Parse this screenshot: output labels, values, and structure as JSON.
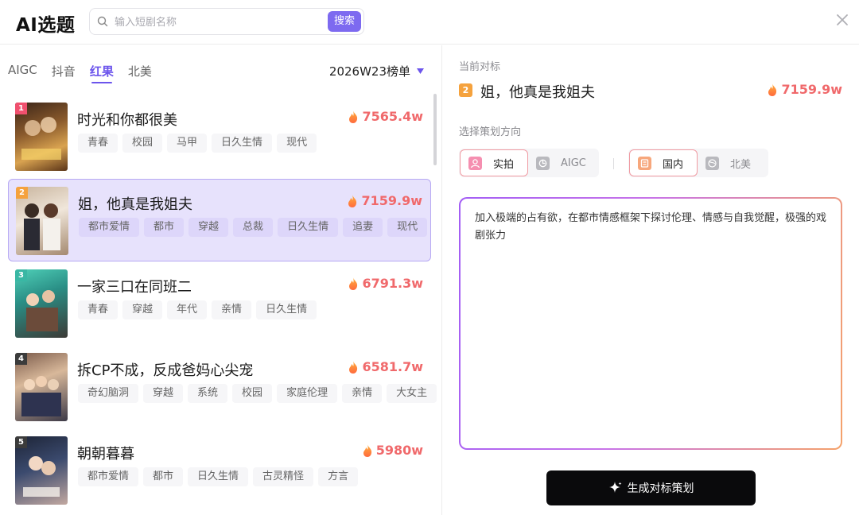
{
  "header": {
    "app_title": "AI选题",
    "search_placeholder": "输入短剧名称",
    "search_button": "搜索"
  },
  "left": {
    "tabs": [
      {
        "label": "AIGC",
        "active": false
      },
      {
        "label": "抖音",
        "active": false
      },
      {
        "label": "红果",
        "active": true
      },
      {
        "label": "北美",
        "active": false
      }
    ],
    "week_label": "2026W23榜单",
    "items": [
      {
        "rank": "1",
        "title": "时光和你都很美",
        "heat": "7565.4w",
        "tags": [
          "青春",
          "校园",
          "马甲",
          "日久生情",
          "现代"
        ],
        "rank_color": "#f0506e"
      },
      {
        "rank": "2",
        "title": "姐，他真是我姐夫",
        "heat": "7159.9w",
        "tags": [
          "都市爱情",
          "都市",
          "穿越",
          "总裁",
          "日久生情",
          "追妻",
          "现代"
        ],
        "rank_color": "#f5a23d"
      },
      {
        "rank": "3",
        "title": "一家三口在同班二",
        "heat": "6791.3w",
        "tags": [
          "青春",
          "穿越",
          "年代",
          "亲情",
          "日久生情"
        ],
        "rank_color": "#39b7a4"
      },
      {
        "rank": "4",
        "title": "拆CP不成，反成爸妈心尖宠",
        "heat": "6581.7w",
        "tags": [
          "奇幻脑洞",
          "穿越",
          "系统",
          "校园",
          "家庭伦理",
          "亲情",
          "大女主"
        ],
        "rank_color": "#3b3b3b"
      },
      {
        "rank": "5",
        "title": "朝朝暮暮",
        "heat": "5980w",
        "tags": [
          "都市爱情",
          "都市",
          "日久生情",
          "古灵精怪",
          "方言"
        ],
        "rank_color": "#3b3b3b"
      }
    ]
  },
  "right": {
    "current_target_label": "当前对标",
    "target": {
      "rank": "2",
      "title": "姐，他真是我姐夫",
      "heat": "7159.9w"
    },
    "direction_label": "选择策划方向",
    "style_options": [
      {
        "label": "实拍",
        "active": true,
        "icon": "camera-person-icon"
      },
      {
        "label": "AIGC",
        "active": false,
        "icon": "ai-icon"
      }
    ],
    "region_options": [
      {
        "label": "国内",
        "active": true,
        "icon": "domestic-icon"
      },
      {
        "label": "北美",
        "active": false,
        "icon": "globe-icon"
      }
    ],
    "prompt_text": "加入极端的占有欲，在都市情感框架下探讨伦理、情感与自我觉醒，极强的戏剧张力",
    "generate_button": "生成对标策划"
  },
  "colors": {
    "accent": "#7d6af0",
    "heat": "#f0696b",
    "selected_bg": "#e7e2fc"
  }
}
